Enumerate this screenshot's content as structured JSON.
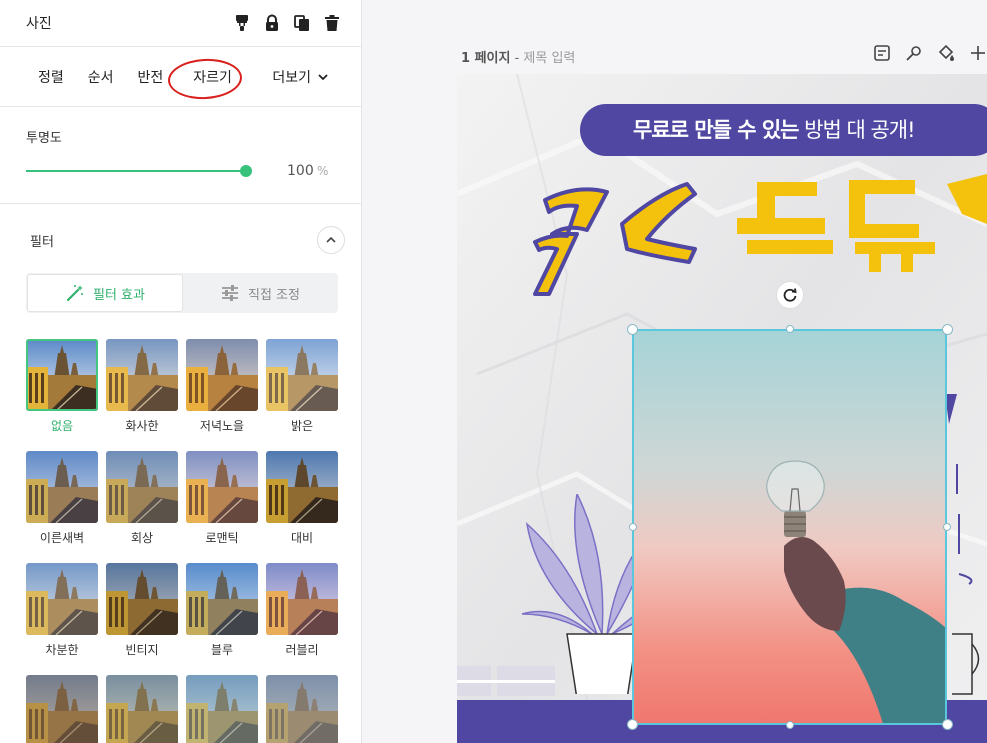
{
  "panel": {
    "title": "사진",
    "header_icons": [
      "paint-roller-icon",
      "lock-icon",
      "copy-icon",
      "trash-icon"
    ],
    "tabs": [
      {
        "label": "정렬"
      },
      {
        "label": "순서"
      },
      {
        "label": "반전"
      },
      {
        "label": "자르기"
      }
    ],
    "more_label": "더보기",
    "opacity": {
      "label": "투명도",
      "value": "100",
      "unit": "%",
      "level": 1.0
    },
    "filter": {
      "title": "필터",
      "toggle": [
        {
          "label": "필터 효과",
          "icon": "magic-wand-icon",
          "active": true
        },
        {
          "label": "직접 조정",
          "icon": "sliders-icon",
          "active": false
        }
      ],
      "items": [
        {
          "label": "없음",
          "selected": true
        },
        {
          "label": "화사한"
        },
        {
          "label": "저녁노을"
        },
        {
          "label": "밝은"
        },
        {
          "label": "이른새벽"
        },
        {
          "label": "회상"
        },
        {
          "label": "로맨틱"
        },
        {
          "label": "대비"
        },
        {
          "label": "차분한"
        },
        {
          "label": "빈티지"
        },
        {
          "label": "블루"
        },
        {
          "label": "러블리"
        },
        {
          "label": ""
        },
        {
          "label": ""
        },
        {
          "label": ""
        },
        {
          "label": ""
        }
      ]
    }
  },
  "editor": {
    "page_number": "1 페이지",
    "separator": " - ",
    "title_placeholder": "제목 입력",
    "tool_icons": [
      "memo-icon",
      "magic-pen-icon",
      "fill-bucket-icon",
      "plus-icon"
    ]
  },
  "canvas": {
    "banner": {
      "bold": "무료로 만들 수 있는",
      "light": " 방법 대 공개!"
    },
    "accent_yellow": "#f4c20d",
    "accent_purple": "#4f47a1"
  },
  "colors": {
    "green": "#36c27a",
    "selection": "#5ac7dd",
    "annotation_red": "#d8201c"
  }
}
